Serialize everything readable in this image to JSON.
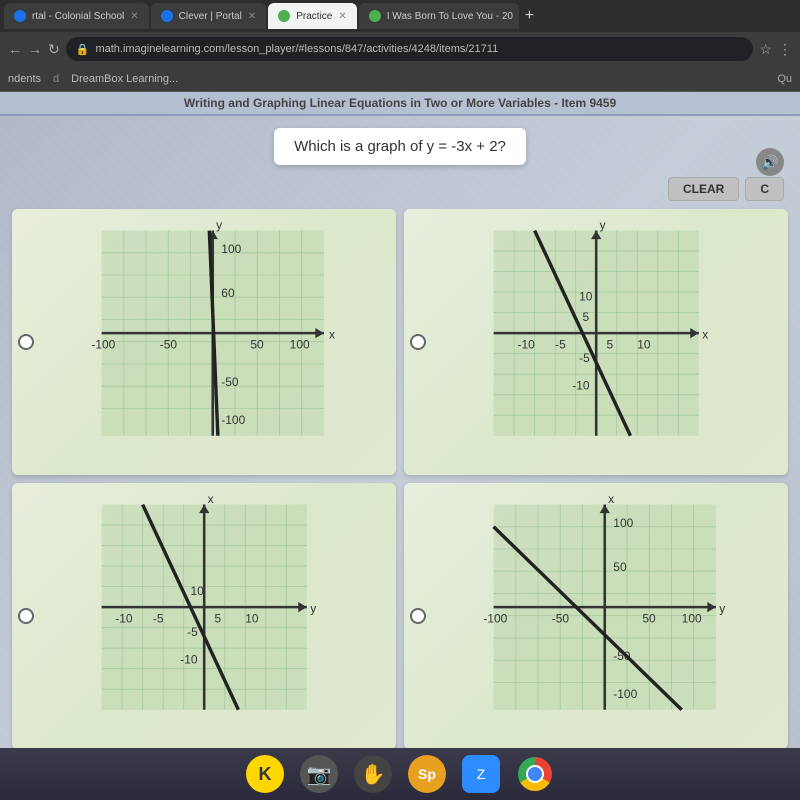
{
  "browser": {
    "tabs": [
      {
        "label": "rtal - Colonial School",
        "active": false,
        "favicon": "blue"
      },
      {
        "label": "Clever | Portal",
        "active": false,
        "favicon": "blue"
      },
      {
        "label": "Practice",
        "active": true,
        "favicon": "green"
      },
      {
        "label": "I Was Born To Love You - 20",
        "active": false,
        "favicon": "green"
      }
    ],
    "address": "math.imaginelearning.com/lesson_player/#lessons/847/activities/4248/items/21711",
    "bookmarks": [
      "ndents",
      "DreamBox Learning..."
    ]
  },
  "lesson": {
    "title": "Writing and Graphing Linear Equations in Two or More Variables - Item 9459",
    "question": "Which is a graph of y = -3x + 2?",
    "toolbar": {
      "clear_label": "CLEAR",
      "check_label": "C"
    }
  },
  "graphs": [
    {
      "id": "graph-a",
      "scale": "large",
      "xMin": -100,
      "xMax": 100,
      "yMin": -100,
      "yMax": 100,
      "slope": -3,
      "intercept": 2,
      "description": "Large scale graph, steep negative slope"
    },
    {
      "id": "graph-b",
      "scale": "small",
      "xMin": -10,
      "xMax": 10,
      "yMin": -10,
      "yMax": 10,
      "slope": -3,
      "intercept": 2,
      "description": "Small scale graph with negative slope"
    },
    {
      "id": "graph-c",
      "scale": "small-alt",
      "xMin": -10,
      "xMax": 10,
      "yMin": -10,
      "yMax": 10,
      "slope": -3,
      "intercept": 2,
      "description": "Small scale graph rotated axes"
    },
    {
      "id": "graph-d",
      "scale": "large-alt",
      "xMin": -100,
      "xMax": 100,
      "yMin": -100,
      "yMax": 100,
      "slope": -3,
      "intercept": 2,
      "description": "Large scale graph variant"
    }
  ],
  "taskbar": {
    "icons": [
      {
        "name": "k-icon",
        "label": "K"
      },
      {
        "name": "camera-icon",
        "label": "📷"
      },
      {
        "name": "hand-icon",
        "label": "✋"
      },
      {
        "name": "sp-icon",
        "label": "Sp"
      },
      {
        "name": "zoom-icon",
        "label": "Z"
      },
      {
        "name": "chrome-icon",
        "label": ""
      }
    ]
  }
}
